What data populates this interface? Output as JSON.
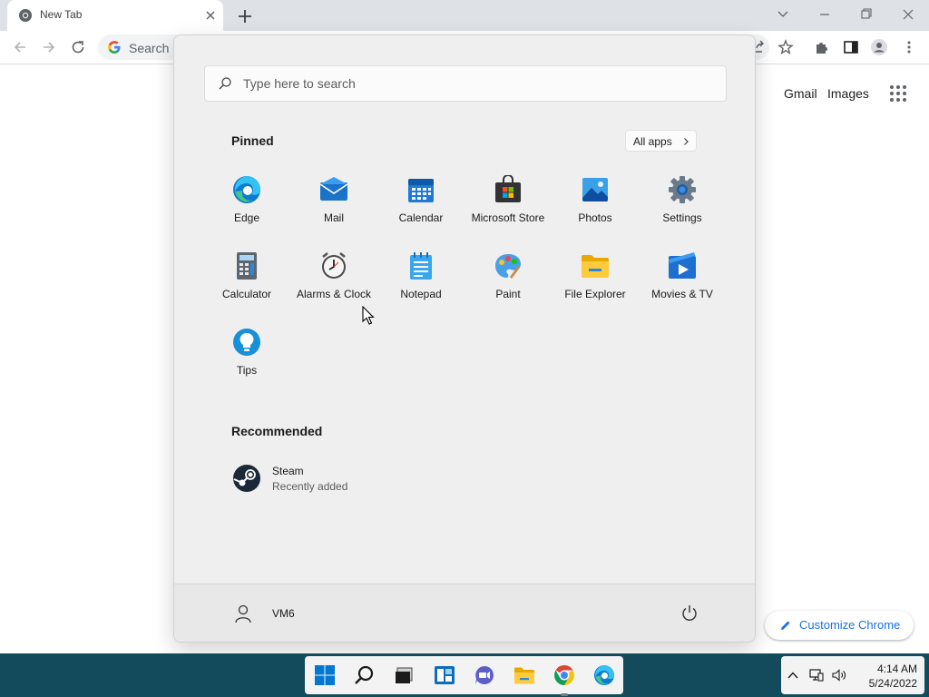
{
  "browser": {
    "tab_title": "New Tab",
    "omnibox_placeholder": "Search G",
    "ntp": {
      "gmail": "Gmail",
      "images": "Images",
      "customize": "Customize Chrome"
    }
  },
  "start_menu": {
    "search_placeholder": "Type here to search",
    "pinned_title": "Pinned",
    "all_apps": "All apps",
    "pinned": [
      {
        "label": "Edge",
        "icon": "edge-icon"
      },
      {
        "label": "Mail",
        "icon": "mail-icon"
      },
      {
        "label": "Calendar",
        "icon": "calendar-icon"
      },
      {
        "label": "Microsoft Store",
        "icon": "store-icon"
      },
      {
        "label": "Photos",
        "icon": "photos-icon"
      },
      {
        "label": "Settings",
        "icon": "settings-icon"
      },
      {
        "label": "Calculator",
        "icon": "calculator-icon"
      },
      {
        "label": "Alarms & Clock",
        "icon": "clock-icon"
      },
      {
        "label": "Notepad",
        "icon": "notepad-icon"
      },
      {
        "label": "Paint",
        "icon": "paint-icon"
      },
      {
        "label": "File Explorer",
        "icon": "folder-icon"
      },
      {
        "label": "Movies & TV",
        "icon": "movies-icon"
      },
      {
        "label": "Tips",
        "icon": "tips-icon"
      }
    ],
    "recommended_title": "Recommended",
    "recommended": [
      {
        "name": "Steam",
        "subtitle": "Recently added",
        "icon": "steam-icon"
      }
    ],
    "user_name": "VM6"
  },
  "taskbar": {
    "apps": [
      "start-icon",
      "search-icon",
      "task-view-icon",
      "widgets-icon",
      "chat-icon",
      "file-explorer-icon",
      "chrome-icon",
      "edge-icon"
    ],
    "time": "4:14 AM",
    "date": "5/24/2022"
  },
  "colors": {
    "taskbar": "#134a5c",
    "start_menu_bg": "#efefef",
    "accent_blue": "#1a73e8"
  }
}
